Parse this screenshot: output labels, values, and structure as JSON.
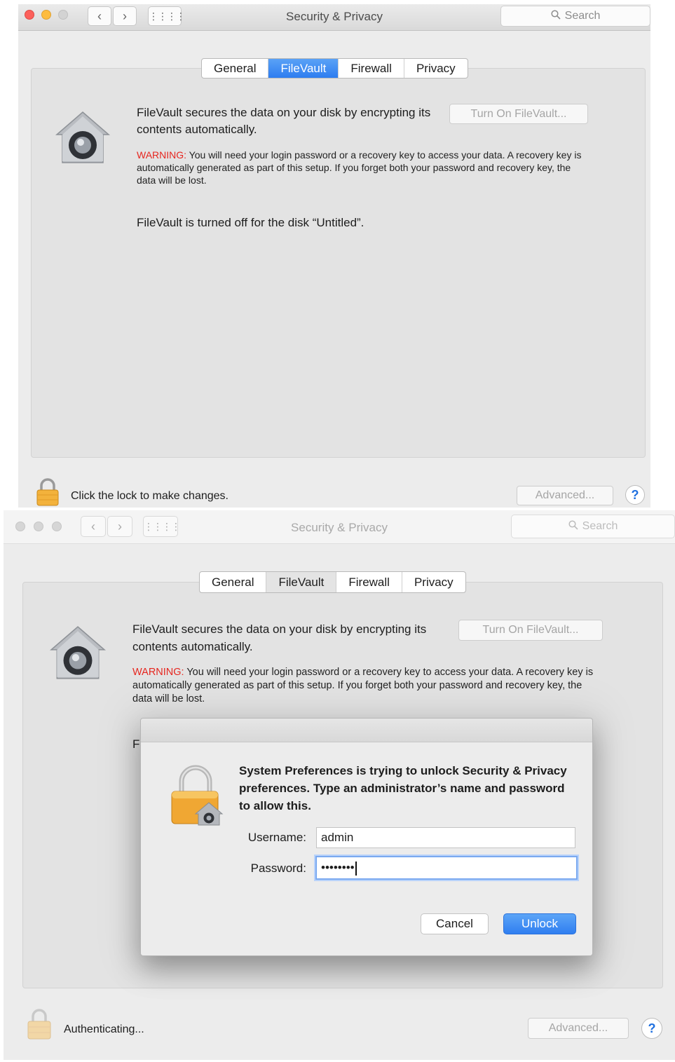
{
  "windows": [
    {
      "title": "Security & Privacy",
      "search_placeholder": "Search",
      "tabs": [
        "General",
        "FileVault",
        "Firewall",
        "Privacy"
      ],
      "selected_tab": "FileVault",
      "description": "FileVault secures the data on your disk by encrypting its contents automatically.",
      "warning_label": "WARNING:",
      "warning_text": " You will need your login password or a recovery key to access your data. A recovery key is automatically generated as part of this setup. If you forget both your password and recovery key, the data will be lost.",
      "status": "FileVault is turned off for the disk “Untitled”.",
      "turn_on_button": "Turn On FileVault...",
      "advanced_button": "Advanced...",
      "help_glyph": "?",
      "lock_text": "Click the lock to make changes."
    },
    {
      "title": "Security & Privacy",
      "search_placeholder": "Search",
      "tabs": [
        "General",
        "FileVault",
        "Firewall",
        "Privacy"
      ],
      "selected_tab": "FileVault",
      "description": "FileVault secures the data on your disk by encrypting its contents automatically.",
      "warning_label": "WARNING:",
      "warning_text": " You will need your login password or a recovery key to access your data. A recovery key is automatically generated as part of this setup. If you forget both your password and recovery key, the data will be lost.",
      "status_fragment": "F",
      "turn_on_button": "Turn On FileVault...",
      "advanced_button": "Advanced...",
      "help_glyph": "?",
      "lock_text": "Authenticating..."
    }
  ],
  "dialog": {
    "message": "System Preferences is trying to unlock Security & Privacy preferences. Type an administrator’s name and password to allow this.",
    "username_label": "Username:",
    "username_value": "admin",
    "password_label": "Password:",
    "password_mask": "••••••••",
    "cancel_button": "Cancel",
    "unlock_button": "Unlock"
  },
  "icons": {
    "back": "chevron-left-icon",
    "forward": "chevron-right-icon",
    "grid": "grid-icon",
    "search": "magnifier-icon",
    "vault": "filevault-house-icon",
    "lock": "padlock-icon"
  },
  "colors": {
    "accent": "#2e7df0",
    "warning": "#e6261f",
    "close": "#fc605b",
    "minimize": "#fdbc40"
  }
}
